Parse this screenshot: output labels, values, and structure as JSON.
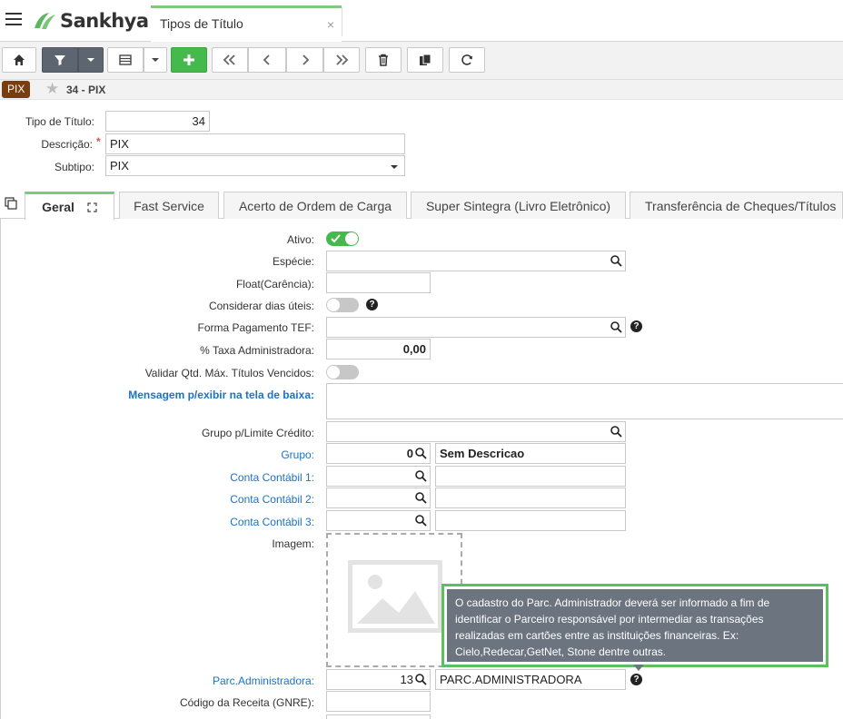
{
  "header": {
    "logo_text": "Sankhya",
    "tab_title": "Tipos de Título",
    "tab_close": "×"
  },
  "breadcrumb": {
    "badge": "PIX",
    "record": "34 - PIX"
  },
  "form": {
    "tipo_label": "Tipo de Título:",
    "tipo_value": "34",
    "descricao_label": "Descrição:",
    "descricao_value": "PIX",
    "required_mark": "*",
    "subtipo_label": "Subtipo:",
    "subtipo_value": "PIX"
  },
  "tabs": [
    {
      "label": "Geral"
    },
    {
      "label": "Fast Service"
    },
    {
      "label": "Acerto de Ordem de Carga"
    },
    {
      "label": "Super Sintegra (Livro Eletrônico)"
    },
    {
      "label": "Transferência de Cheques/Títulos"
    }
  ],
  "geral": {
    "ativo_label": "Ativo:",
    "ativo_on": true,
    "especie_label": "Espécie:",
    "float_label": "Float(Carência):",
    "considerar_label": "Considerar dias úteis:",
    "forma_tef_label": "Forma Pagamento TEF:",
    "taxa_label": "% Taxa Administradora:",
    "taxa_value": "0,00",
    "validar_label": "Validar Qtd. Máx. Títulos Vencidos:",
    "mensagem_label": "Mensagem p/exibir na tela de baixa:",
    "grupo_limite_label": "Grupo p/Limite Crédito:",
    "grupo_label": "Grupo:",
    "grupo_value": "0",
    "grupo_desc": "Sem Descricao",
    "conta1_label": "Conta Contábil 1:",
    "conta2_label": "Conta Contábil 2:",
    "conta3_label": "Conta Contábil 3:",
    "imagem_label": "Imagem:",
    "parc_label": "Parc.Administradora:",
    "parc_value": "13",
    "parc_desc": "PARC.ADMINISTRADORA",
    "codigo_receita_label": "Código da Receita (GNRE):",
    "help_glyph": "?"
  },
  "tooltip": {
    "text": "O cadastro do Parc. Administrador deverá ser informado a fim de identificar o Parceiro responsável por intermediar as transações realizadas em cartões entre as instituições financeiras. Ex: Cielo,Redecar,GetNet, Stone dentre outras."
  },
  "colors": {
    "accent_green": "#46b94d",
    "brand_brown": "#7a3e0e",
    "link_blue": "#1a73c8",
    "tooltip_bg": "#6c7480"
  }
}
